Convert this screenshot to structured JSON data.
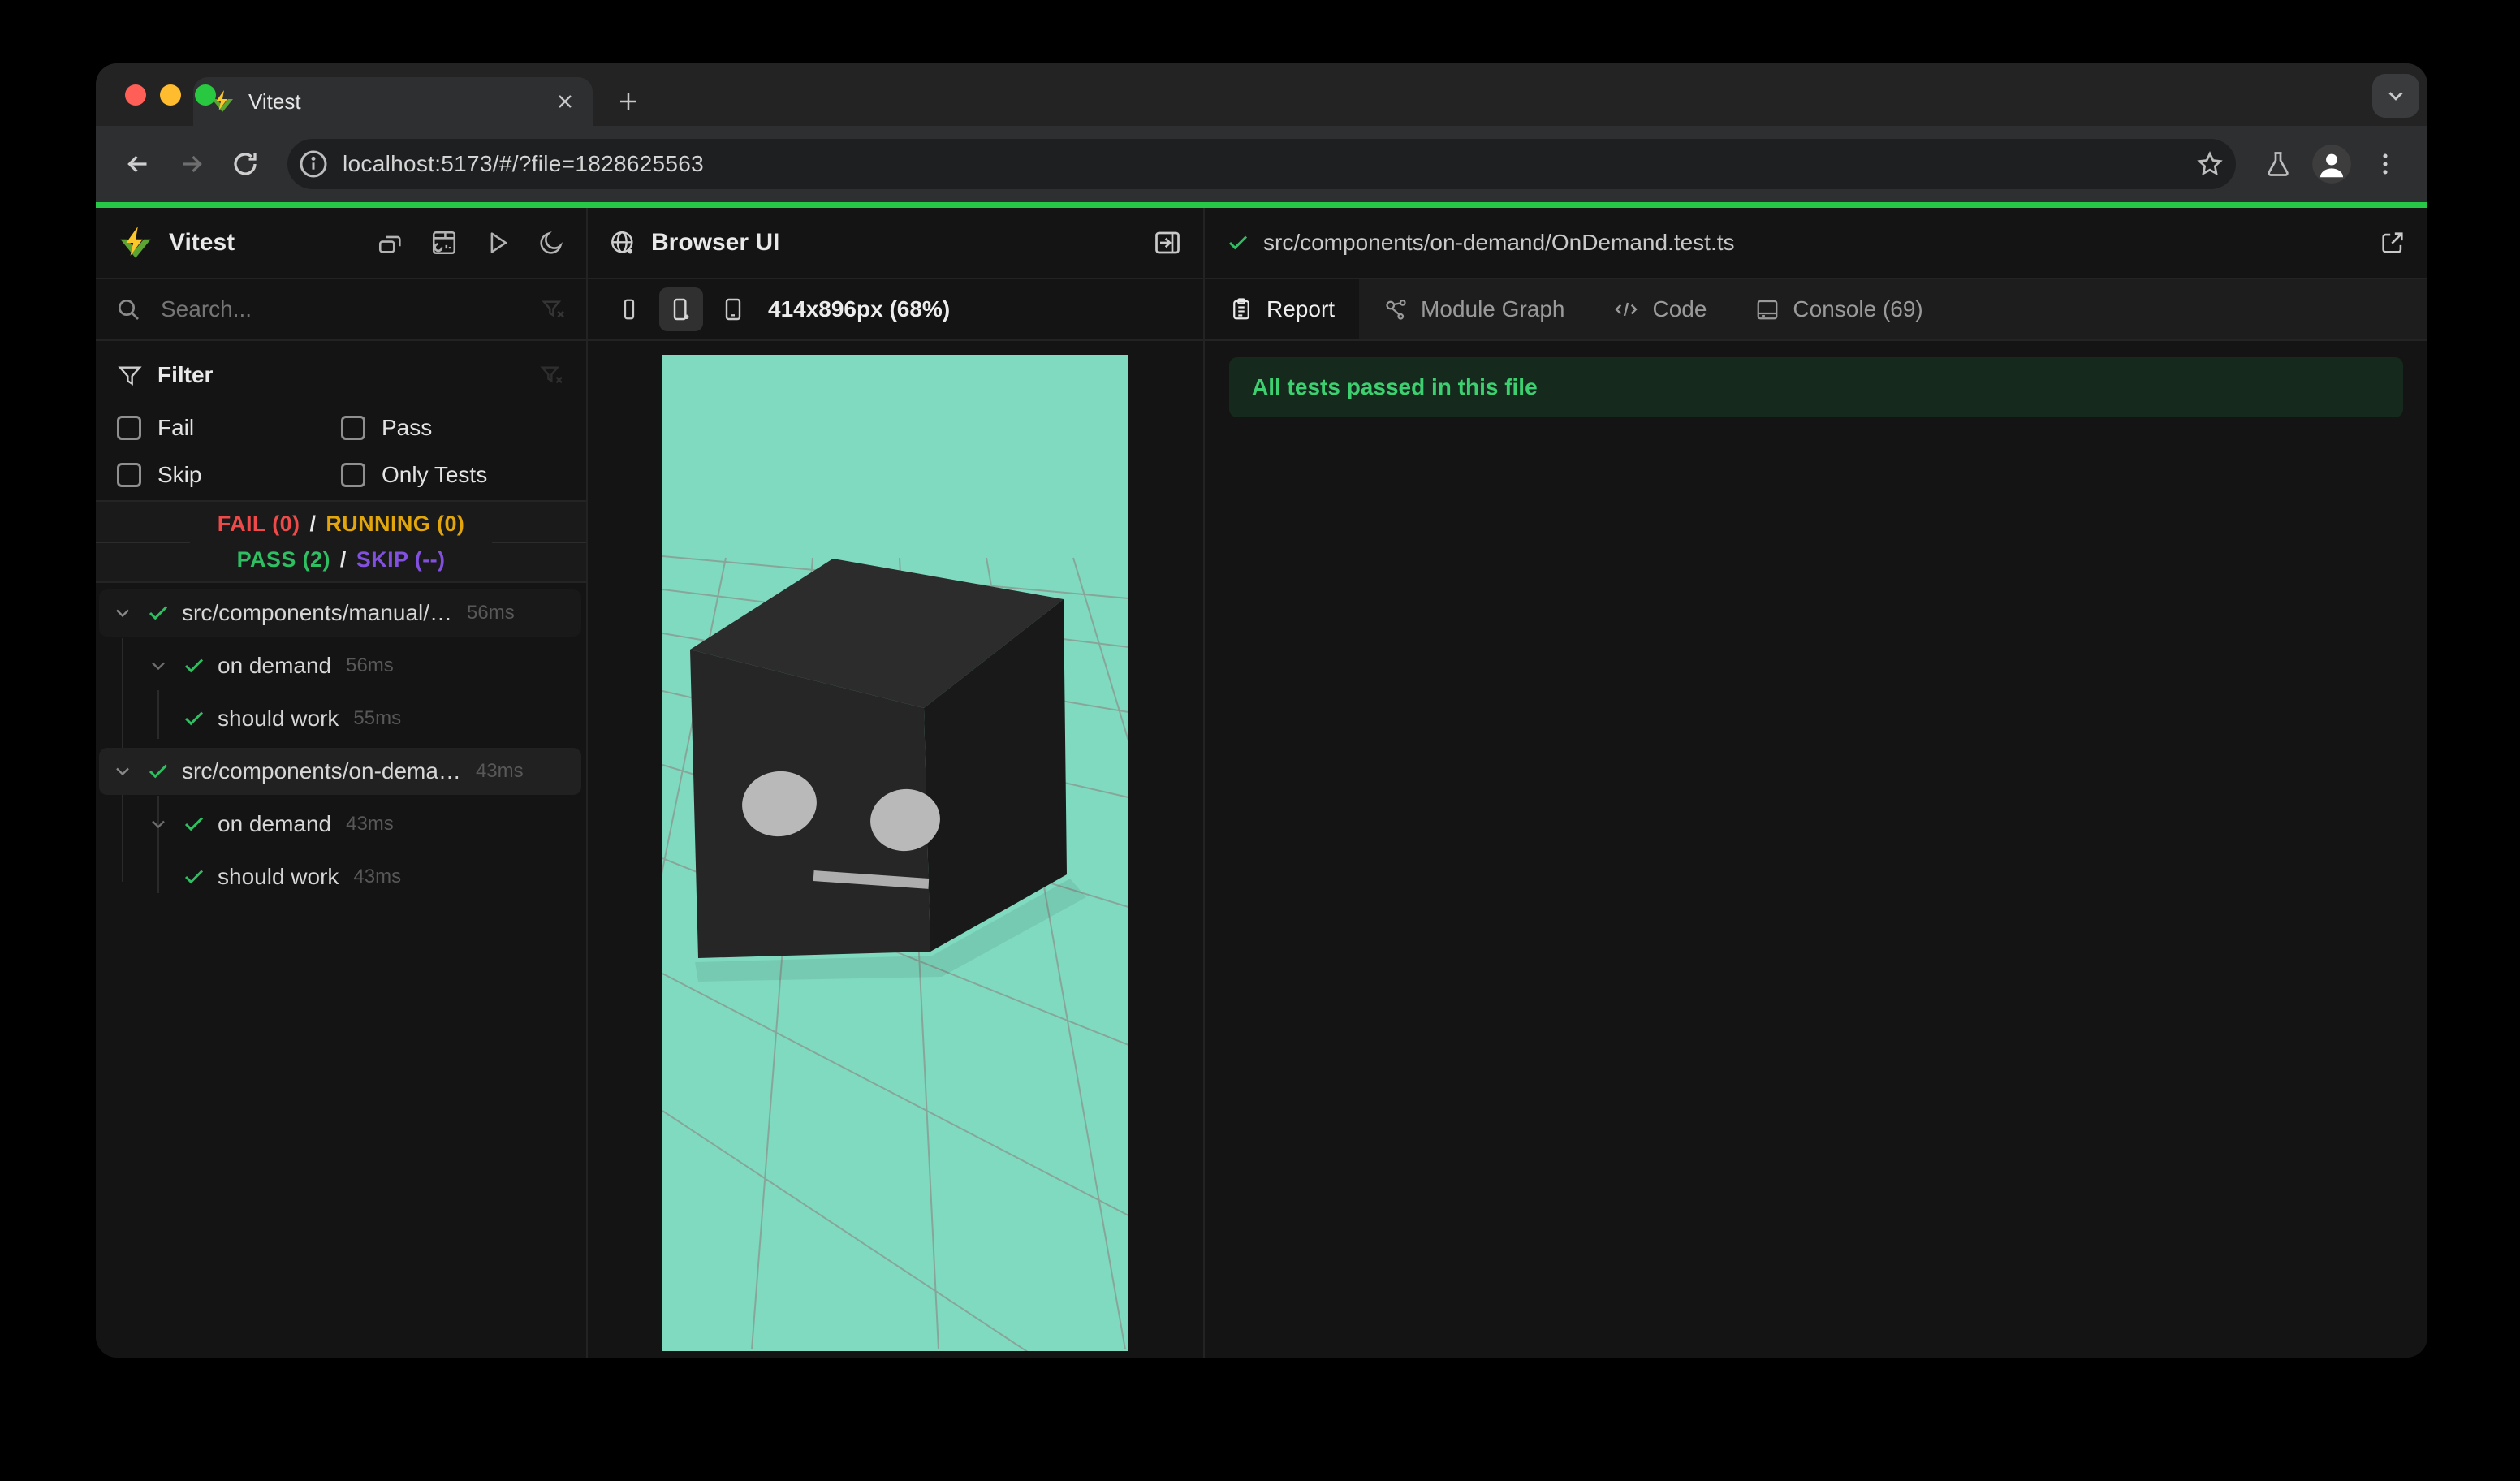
{
  "browser": {
    "tab_title": "Vitest",
    "url": "localhost:5173/#/?file=1828625563"
  },
  "sidebar": {
    "app_title": "Vitest",
    "search_placeholder": "Search...",
    "filter": {
      "title": "Filter",
      "options": [
        "Fail",
        "Pass",
        "Skip",
        "Only Tests"
      ]
    },
    "status": {
      "fail_label": "FAIL (0)",
      "running_label": "RUNNING (0)",
      "pass_label": "PASS (2)",
      "skip_label": "SKIP (--)",
      "sep": "/"
    },
    "tree": [
      {
        "name": "src/components/manual/…",
        "duration": "56ms"
      },
      {
        "name": "on demand",
        "duration": "56ms"
      },
      {
        "name": "should work",
        "duration": "55ms"
      },
      {
        "name": "src/components/on-dema…",
        "duration": "43ms"
      },
      {
        "name": "on demand",
        "duration": "43ms"
      },
      {
        "name": "should work",
        "duration": "43ms"
      }
    ]
  },
  "middle": {
    "title": "Browser UI",
    "size_label": "414x896px (68%)"
  },
  "right": {
    "file_path": "src/components/on-demand/OnDemand.test.ts",
    "tabs": [
      "Report",
      "Module Graph",
      "Code",
      "Console (69)"
    ],
    "banner": "All tests passed in this file"
  },
  "colors": {
    "accent_green": "#27c747",
    "pass": "#2fbe62",
    "fail": "#ef4a4a",
    "running": "#e2a50c",
    "skip": "#8250df",
    "viewport_bg": "#7fdac0",
    "banner_bg": "#152a1c",
    "banner_text": "#3dcf70"
  }
}
